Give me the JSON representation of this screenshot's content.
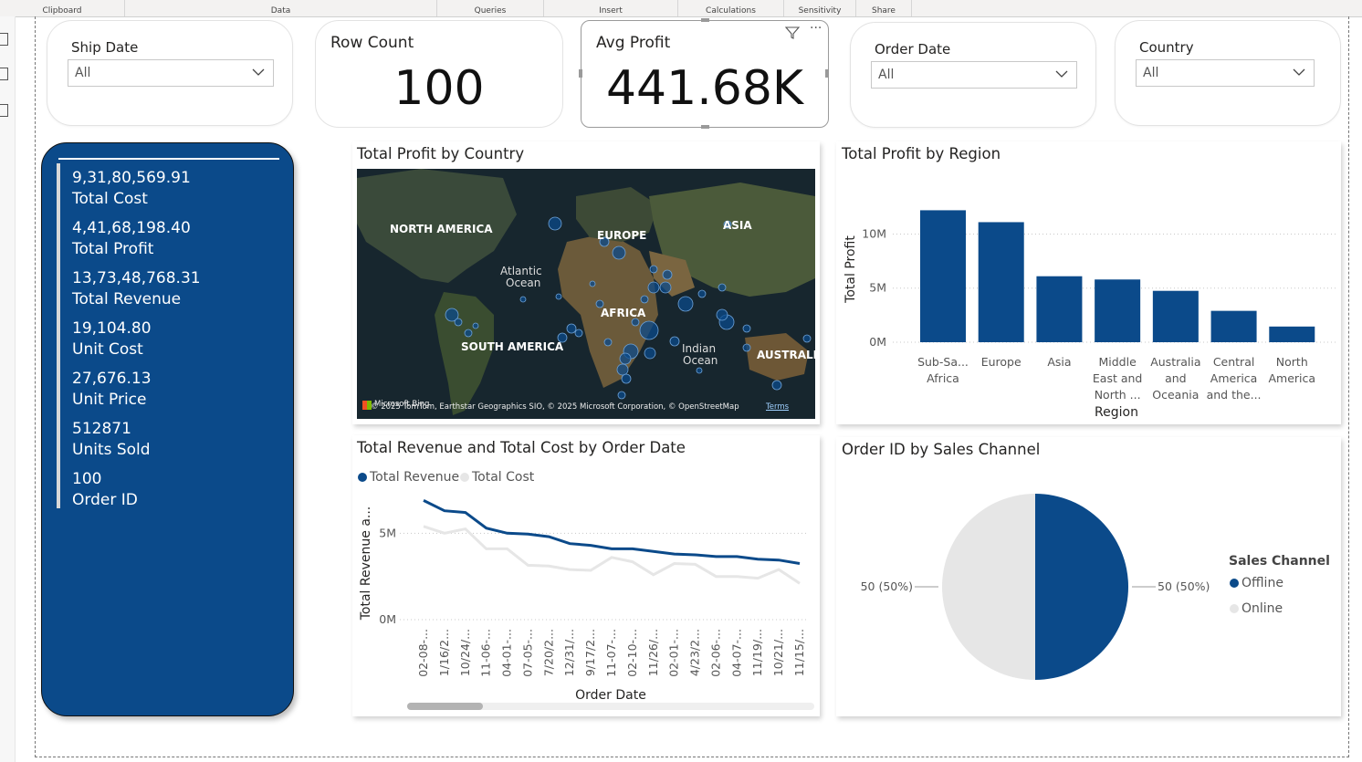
{
  "ribbon": {
    "groups": [
      "Clipboard",
      "Data",
      "Queries",
      "Insert",
      "Calculations",
      "Sensitivity",
      "Share"
    ]
  },
  "slicers": {
    "ship_date": {
      "title": "Ship Date",
      "value": "All"
    },
    "order_date": {
      "title": "Order Date",
      "value": "All"
    },
    "country": {
      "title": "Country",
      "value": "All"
    }
  },
  "cards": {
    "row_count": {
      "title": "Row Count",
      "value": "100"
    },
    "avg_profit": {
      "title": "Avg Profit",
      "value": "441.68K",
      "menu": "···"
    }
  },
  "kpis": [
    {
      "value": "9,31,80,569.91",
      "label": "Total Cost"
    },
    {
      "value": "4,41,68,198.40",
      "label": "Total Profit"
    },
    {
      "value": "13,73,48,768.31",
      "label": "Total Revenue"
    },
    {
      "value": "19,104.80",
      "label": "Unit Cost"
    },
    {
      "value": "27,676.13",
      "label": "Unit Price"
    },
    {
      "value": "512871",
      "label": "Units Sold"
    },
    {
      "value": "100",
      "label": "Order ID"
    }
  ],
  "map": {
    "title": "Total Profit by Country",
    "labels": {
      "north_america": "NORTH AMERICA",
      "europe": "EUROPE",
      "asia": "ASIA",
      "atlantic": "Atlantic",
      "ocean1": "Ocean",
      "africa": "AFRICA",
      "south_america": "SOUTH AMERICA",
      "indian": "Indian",
      "ocean2": "Ocean",
      "australia": "AUSTRALI"
    },
    "attribution": "© 2025 TomTom, Earthstar Geographics SIO, © 2025 Microsoft Corporation, © OpenStreetMap",
    "terms": "Terms",
    "bing": "Microsoft Bing"
  },
  "colors": {
    "primary": "#0b4a8a",
    "secondary": "#e6e6e6",
    "map_bg": "#1f2a2e"
  },
  "chart_data": [
    {
      "type": "bar",
      "title": "Total Profit by Region",
      "xlabel": "Region",
      "ylabel": "Total Profit",
      "categories": [
        [
          "Sub-Sa...",
          "Africa"
        ],
        [
          "Europe"
        ],
        [
          "Asia"
        ],
        [
          "Middle",
          "East and",
          "North ..."
        ],
        [
          "Australia",
          "and",
          "Oceania"
        ],
        [
          "Central",
          "America",
          "and the..."
        ],
        [
          "North",
          "America"
        ]
      ],
      "values": [
        12200000,
        11100000,
        6100000,
        5800000,
        4750000,
        2900000,
        1450000
      ],
      "yticks": [
        "0M",
        "5M",
        "10M"
      ],
      "ylim": [
        0,
        13500000
      ]
    },
    {
      "type": "line",
      "title": "Total Revenue and Total Cost by Order Date",
      "xlabel": "Order Date",
      "ylabel": "Total Revenue a...",
      "categories": [
        "02-08-...",
        "1/16/2...",
        "10/24/...",
        "11-06-...",
        "04-01-...",
        "07-05-...",
        "7/20/2...",
        "12/31/...",
        "9/17/2...",
        "11-07-...",
        "02-10-...",
        "11/26/...",
        "02-01-...",
        "4/23/2...",
        "02-06-...",
        "04-07-...",
        "11/19/...",
        "10/21/...",
        "11/15/..."
      ],
      "series": [
        {
          "name": "Total Revenue",
          "values": [
            6900000,
            6300000,
            6200000,
            5300000,
            5000000,
            4950000,
            4800000,
            4400000,
            4300000,
            4100000,
            4100000,
            3950000,
            3800000,
            3750000,
            3650000,
            3650000,
            3500000,
            3450000,
            3250000
          ]
        },
        {
          "name": "Total Cost",
          "values": [
            5400000,
            5000000,
            5250000,
            4100000,
            4100000,
            3150000,
            3100000,
            2900000,
            2850000,
            3600000,
            3350000,
            2600000,
            3250000,
            3200000,
            2500000,
            2500000,
            2400000,
            2900000,
            2100000
          ]
        }
      ],
      "yticks": [
        "0M",
        "5M"
      ],
      "ylim": [
        0,
        7500000
      ]
    },
    {
      "type": "pie",
      "title": "Order ID by Sales Channel",
      "legend_title": "Sales Channel",
      "slices": [
        {
          "label": "Offline",
          "value": 50,
          "text": "50 (50%)"
        },
        {
          "label": "Online",
          "value": 50,
          "text": "50 (50%)"
        }
      ]
    }
  ]
}
